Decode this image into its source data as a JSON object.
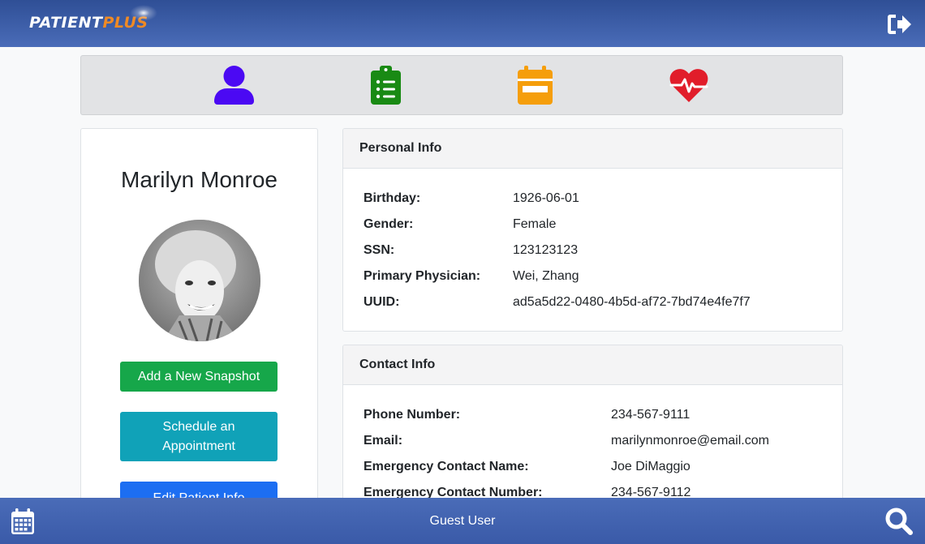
{
  "header": {
    "logo_main": "PATIENT",
    "logo_accent": "PLUS",
    "logout_icon": "sign-out-icon"
  },
  "nav_icons": [
    {
      "name": "user-icon",
      "color": "#4b09f3"
    },
    {
      "name": "clipboard-list-icon",
      "color": "#198a14"
    },
    {
      "name": "calendar-icon",
      "color": "#f59e0b"
    },
    {
      "name": "heartbeat-icon",
      "color": "#e11d2a"
    }
  ],
  "profile": {
    "name": "Marilyn Monroe",
    "buttons": {
      "snapshot": "Add a New Snapshot",
      "schedule": "Schedule an Appointment",
      "edit": "Edit Patient Info"
    }
  },
  "personal_info": {
    "title": "Personal Info",
    "rows": [
      {
        "label": "Birthday:",
        "value": "1926-06-01"
      },
      {
        "label": "Gender:",
        "value": "Female"
      },
      {
        "label": "SSN:",
        "value": "123123123"
      },
      {
        "label": "Primary Physician:",
        "value": "Wei, Zhang"
      },
      {
        "label": "UUID:",
        "value": "ad5a5d22-0480-4b5d-af72-7bd74e4fe7f7"
      }
    ]
  },
  "contact_info": {
    "title": "Contact Info",
    "rows": [
      {
        "label": "Phone Number:",
        "value": "234-567-9111"
      },
      {
        "label": "Email:",
        "value": "marilynmonroe@email.com"
      },
      {
        "label": "Emergency Contact Name:",
        "value": "Joe DiMaggio"
      },
      {
        "label": "Emergency Contact Number:",
        "value": "234-567-9112"
      }
    ]
  },
  "footer": {
    "user": "Guest User",
    "left_icon": "calendar-icon",
    "right_icon": "search-icon"
  }
}
